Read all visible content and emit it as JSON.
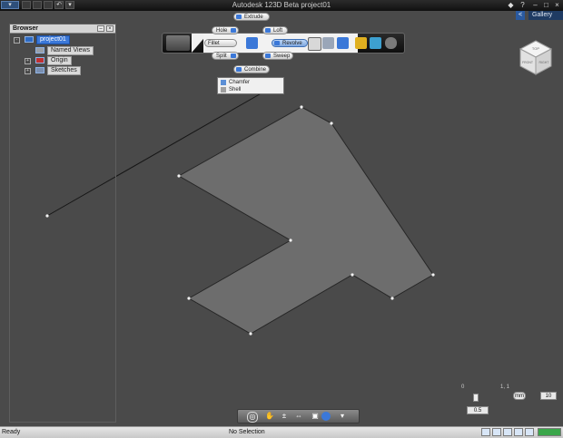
{
  "window": {
    "title": "Autodesk 123D Beta   project01",
    "help_label": "?"
  },
  "gallery": {
    "label": "Gallery",
    "toggle": "<"
  },
  "browser": {
    "title": "Browser",
    "project": "project01",
    "items": [
      {
        "label": "Named Views"
      },
      {
        "label": "Origin"
      },
      {
        "label": "Sketches"
      }
    ]
  },
  "toolbar": {
    "pills": {
      "extrude": "Extrude",
      "hole": "Hole",
      "loft": "Loft",
      "fillet": "Fillet",
      "revolve": "Revolve",
      "split": "Split",
      "sweep": "Sweep",
      "combine": "Combine"
    },
    "dropdown": [
      "Chamfer",
      "Shell"
    ]
  },
  "viewcube": {
    "top": "TOP",
    "front": "FRONT",
    "right": "RIGHT"
  },
  "scale": {
    "left_tick": "0",
    "right_tick": "1, 1",
    "marker": "1",
    "value": "0.5",
    "unit": "mm",
    "input": "10"
  },
  "status": {
    "left": "Ready",
    "center": "No Selection"
  },
  "colors": {
    "canvas": "#4a4a4a",
    "profile_fill": "#6d6d6d",
    "accent": "#3b78d8"
  }
}
